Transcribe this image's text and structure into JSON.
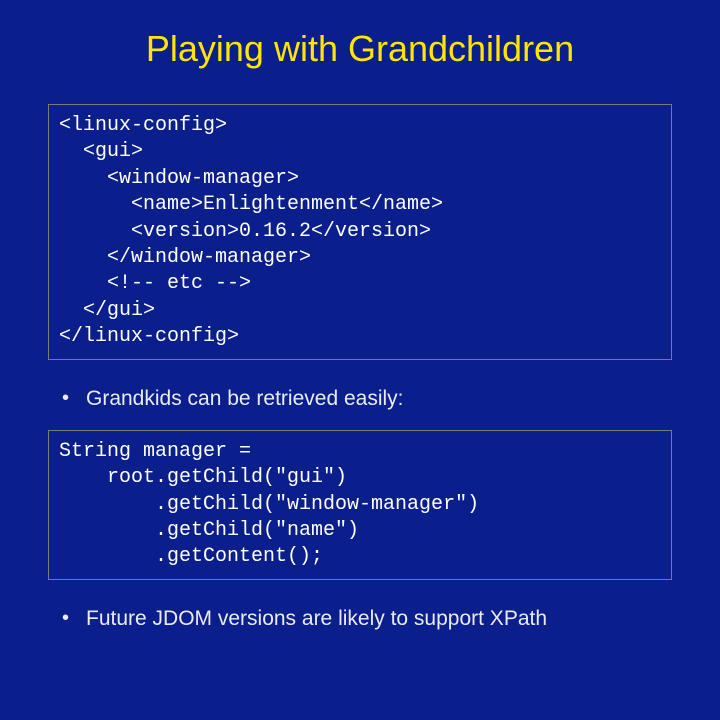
{
  "title": "Playing with Grandchildren",
  "code1": "<linux-config>\n  <gui>\n    <window-manager>\n      <name>Enlightenment</name>\n      <version>0.16.2</version>\n    </window-manager>\n    <!-- etc -->\n  </gui>\n</linux-config>",
  "bullet1": "Grandkids can be retrieved easily:",
  "code2": "String manager =\n    root.getChild(\"gui\")\n        .getChild(\"window-manager\")\n        .getChild(\"name\")\n        .getContent();",
  "bullet2": "Future JDOM versions are likely to support XPath"
}
